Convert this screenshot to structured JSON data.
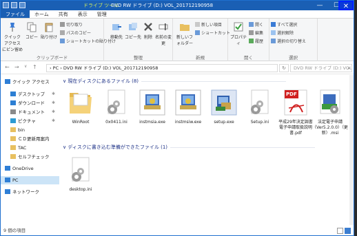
{
  "titlebar": {
    "context_tab": "ドライブ ツール",
    "title": "DVD RW ドライブ (D:) VOL_201712190958",
    "minimize": "—",
    "maximize": "☐",
    "close": "✕"
  },
  "tabs": {
    "file": "ファイル",
    "home": "ホーム",
    "share": "共有",
    "view": "表示",
    "manage": "管理"
  },
  "ribbon": {
    "clipboard": {
      "label": "クリップボード",
      "pin": "クイック アクセス にピン留め",
      "copy": "コピー",
      "paste": "貼り付け",
      "cut": "切り取り",
      "copy_path": "パスのコピー",
      "paste_shortcut": "ショートカットの貼り付け"
    },
    "organize": {
      "label": "整理",
      "move_to": "移動先",
      "copy_to": "コピー先",
      "delete": "削除",
      "rename": "名前の変更"
    },
    "new": {
      "label": "新規",
      "new_folder": "新しいフォルダー",
      "new_item": "新しい項目",
      "shortcut": "ショートカット"
    },
    "open": {
      "label": "開く",
      "properties": "プロパティ",
      "open": "開く",
      "edit": "編集",
      "history": "履歴"
    },
    "select": {
      "label": "選択",
      "select_all": "すべて選択",
      "select_none": "選択解除",
      "invert": "選択の切り替え"
    }
  },
  "address": {
    "path": "› PC › DVD RW ドライブ (D:) VOL_201712190958",
    "search_placeholder": "DVD RW ドライブ (D:) VOL_2017...",
    "back": "←",
    "forward": "→",
    "up": "↑",
    "refresh": "↻",
    "search_icon": "⌕"
  },
  "nav": {
    "items": [
      {
        "label": "クイック アクセス",
        "icon": "star-icon",
        "color": "#2f7fd6"
      },
      {
        "label": "デスクトップ",
        "icon": "desktop-icon",
        "color": "#2d7fd3",
        "pinned": true
      },
      {
        "label": "ダウンロード",
        "icon": "download-icon",
        "color": "#2d7fd3",
        "pinned": true
      },
      {
        "label": "ドキュメント",
        "icon": "document-icon",
        "color": "#8a8a8a",
        "pinned": true
      },
      {
        "label": "ピクチャ",
        "icon": "picture-icon",
        "color": "#2d9bd3",
        "pinned": true
      },
      {
        "label": "bin",
        "icon": "folder-icon",
        "color": "#e8c060"
      },
      {
        "label": "ＣＤ更新用案内",
        "icon": "folder-icon",
        "color": "#e8c060"
      },
      {
        "label": "TAC",
        "icon": "folder-icon",
        "color": "#e8c060"
      },
      {
        "label": "セルフチェック",
        "icon": "folder-icon",
        "color": "#e8c060"
      },
      {
        "label": "OneDrive",
        "icon": "cloud-icon",
        "color": "#2f7fd6"
      },
      {
        "label": "PC",
        "icon": "pc-icon",
        "color": "#2f7fd6",
        "selected": true
      },
      {
        "label": "ネットワーク",
        "icon": "network-icon",
        "color": "#2f7fd6"
      }
    ],
    "pin_glyph": "✱"
  },
  "content": {
    "group1_header": "∨ 現在ディスクにあるファイル (8)",
    "group2_header": "∨ ディスクに書き込む準備ができたファイル (1)",
    "files": [
      {
        "label": "WinRoot",
        "icon": "folder-icon"
      },
      {
        "label": "0x0411.ini",
        "icon": "settings-file-icon"
      },
      {
        "label": "instmsia.exe",
        "icon": "installer-icon"
      },
      {
        "label": "instmsiw.exe",
        "icon": "installer-icon"
      },
      {
        "label": "setup.exe",
        "icon": "setup-icon"
      },
      {
        "label": "Setup.ini",
        "icon": "settings-file-icon"
      },
      {
        "label": "平成29年決定調書電子申請取扱説明書.pdf",
        "icon": "pdf-icon"
      },
      {
        "label": "法定電子申請（Ver5.2.0.0）（更新）.msi",
        "icon": "msi-icon"
      }
    ],
    "pending": [
      {
        "label": "desktop.ini",
        "icon": "settings-file-icon"
      }
    ],
    "pdf_badge": "PDF"
  },
  "status": {
    "text": "9 個の項目"
  }
}
